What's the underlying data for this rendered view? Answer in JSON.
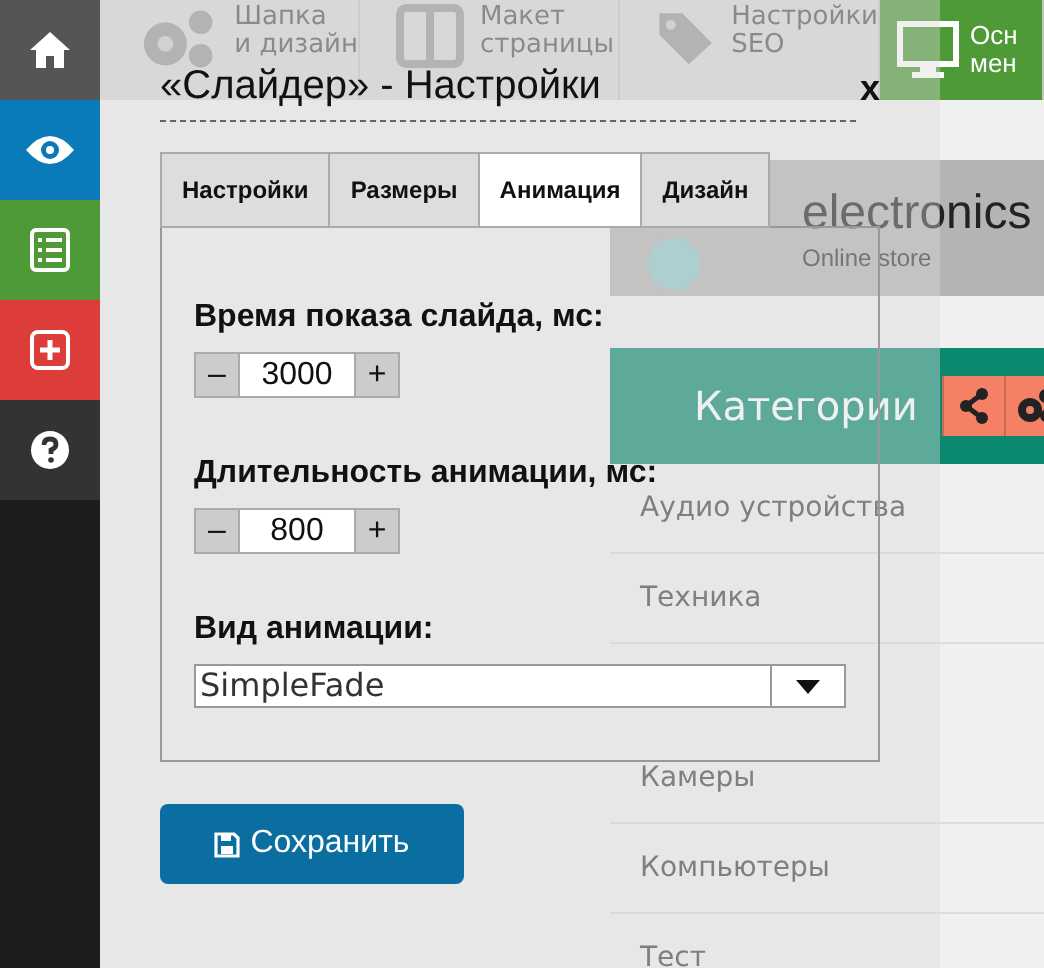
{
  "sidebar": {
    "items": [
      {
        "kind": "home",
        "color": "#555555"
      },
      {
        "kind": "eye",
        "color": "#0a7ab8"
      },
      {
        "kind": "list",
        "color": "#4e9a36"
      },
      {
        "kind": "plus",
        "color": "#dc3d3a"
      },
      {
        "kind": "help",
        "color": "#333333"
      }
    ]
  },
  "toolbar": {
    "items": [
      {
        "kind": "gears",
        "lines": [
          "Шапка",
          "и дизайн"
        ]
      },
      {
        "kind": "layout",
        "lines": [
          "Макет",
          "страницы"
        ]
      },
      {
        "kind": "tag",
        "lines": [
          "Настройки",
          "SEO"
        ]
      },
      {
        "kind": "monitor",
        "lines": [
          "Осн",
          "мен"
        ]
      }
    ]
  },
  "site": {
    "logo": "electronics",
    "tagline": "Online store",
    "categories": "Категории",
    "list": [
      "Аудио устройства",
      "Техника",
      "Камеры",
      "Компьютеры",
      "Тест"
    ]
  },
  "modal": {
    "title": "«Слайдер» - Настройки",
    "close": "x",
    "tabs": [
      {
        "label": "Настройки",
        "selected": false
      },
      {
        "label": "Размеры",
        "selected": false
      },
      {
        "label": "Анимация",
        "selected": true
      },
      {
        "label": "Дизайн",
        "selected": false
      }
    ],
    "fields": [
      {
        "kind": "stepper",
        "label": "Время показа слайда, мс:",
        "value": "3000",
        "minus": "–",
        "plus": "+"
      },
      {
        "kind": "stepper",
        "label": "Длительность анимации, мс:",
        "value": "800",
        "minus": "–",
        "plus": "+"
      },
      {
        "kind": "select",
        "label": "Вид анимации:",
        "value": "SimpleFade"
      }
    ],
    "save": "Сохранить"
  }
}
